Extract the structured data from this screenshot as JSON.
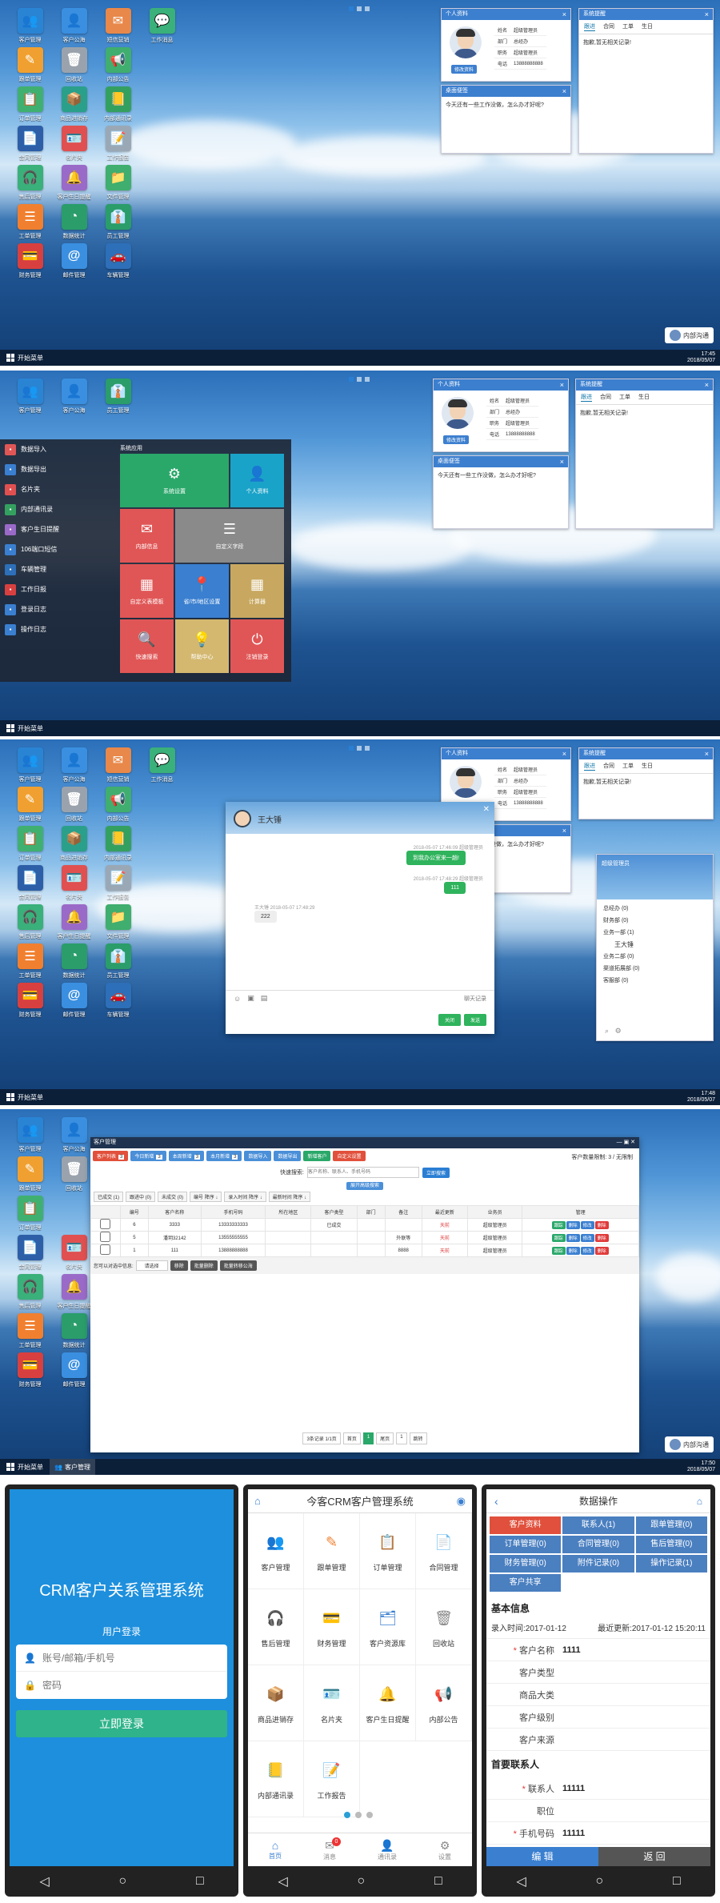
{
  "taskbar": {
    "start": "开始菜单",
    "time1": "17:45",
    "date1": "2018/05/07",
    "time3": "17:48",
    "date3": "2018/05/07",
    "time4": "17:50",
    "date4": "2018/05/07",
    "task_crm": "客户管理"
  },
  "desktop": {
    "icons": [
      {
        "label": "客户管理",
        "icon": "user-icon",
        "color": "#2a84d4",
        "glyph": "👥"
      },
      {
        "label": "客户公海",
        "icon": "users-icon",
        "color": "#3a8fe0",
        "glyph": "👤"
      },
      {
        "label": "短信营销",
        "icon": "mail-icon",
        "color": "#e8884a",
        "glyph": "✉"
      },
      {
        "label": "工作消息",
        "icon": "chat-icon",
        "color": "#3ab07a",
        "glyph": "💬"
      },
      {
        "label": "跟单管理",
        "icon": "edit-icon",
        "color": "#f0a030",
        "glyph": "✎"
      },
      {
        "label": "回收站",
        "icon": "trash-icon",
        "color": "#9aa3ad",
        "glyph": "🗑"
      },
      {
        "label": "内部公告",
        "icon": "notice-icon",
        "color": "#3fae6e",
        "glyph": "📢"
      },
      {
        "label": "订单管理",
        "icon": "order-icon",
        "color": "#40b070",
        "glyph": "📋"
      },
      {
        "label": "商品进销存",
        "icon": "box-icon",
        "color": "#2aa08a",
        "glyph": "📦"
      },
      {
        "label": "内部通讯录",
        "icon": "contacts-icon",
        "color": "#34a060",
        "glyph": "📒"
      },
      {
        "label": "合同管理",
        "icon": "contract-icon",
        "color": "#2d5fa8",
        "glyph": "📄"
      },
      {
        "label": "名片夹",
        "icon": "card-icon",
        "color": "#e05050",
        "glyph": "🪪"
      },
      {
        "label": "工作报告",
        "icon": "report-icon",
        "color": "#9aa8b6",
        "glyph": "📝"
      },
      {
        "label": "售后管理",
        "icon": "service-icon",
        "color": "#3ab07a",
        "glyph": "🎧"
      },
      {
        "label": "客户生日提醒",
        "icon": "bell-icon",
        "color": "#9a6ac8",
        "glyph": "🔔"
      },
      {
        "label": "文件管理",
        "icon": "folder-icon",
        "color": "#3fae6e",
        "glyph": "📁"
      },
      {
        "label": "工单管理",
        "icon": "list-icon",
        "color": "#f08030",
        "glyph": "☰"
      },
      {
        "label": "数据统计",
        "icon": "pie-icon",
        "color": "#2a9d6a",
        "glyph": "◔"
      },
      {
        "label": "员工管理",
        "icon": "staff-icon",
        "color": "#2a9d6a",
        "glyph": "👔"
      },
      {
        "label": "财务管理",
        "icon": "wallet-icon",
        "color": "#d84040",
        "glyph": "💳"
      },
      {
        "label": "邮件管理",
        "icon": "at-icon",
        "color": "#3a8fe0",
        "glyph": "@"
      },
      {
        "label": "车辆管理",
        "icon": "car-icon",
        "color": "#2d6fb8",
        "glyph": "🚗"
      }
    ]
  },
  "profile": {
    "title": "个人资料",
    "edit": "修改资料",
    "rows": [
      [
        "姓名",
        "超级管理员"
      ],
      [
        "部门",
        "总经办"
      ],
      [
        "职务",
        "超级管理员"
      ],
      [
        "电话",
        "13888888888"
      ]
    ]
  },
  "remind": {
    "title": "系统提醒",
    "tabs": [
      "跟进",
      "合同",
      "工单",
      "生日"
    ],
    "empty": "抱歉,暂无相关记录!"
  },
  "memo": {
    "title": "桌面便签",
    "text": "今天还有一些工作没做，怎么办才好呢?"
  },
  "internal_chat": {
    "label": "内部沟通"
  },
  "start_menu": {
    "list": [
      "数据导入",
      "数据导出",
      "名片夹",
      "内部通讯录",
      "客户生日提醒",
      "106端口短信",
      "车辆管理",
      "工作日报",
      "登录日志",
      "操作日志"
    ],
    "title": "系统应用",
    "tiles": [
      {
        "label": "系统设置",
        "color": "#2aa86a",
        "glyph": "⚙"
      },
      {
        "label": "个人资料",
        "color": "#1aa3c8",
        "glyph": "👤"
      },
      {
        "label": "内部信息",
        "color": "#e05656",
        "glyph": "✉"
      },
      {
        "label": "自定义字段",
        "color": "#8a8a8a",
        "glyph": "☰"
      },
      {
        "label": "自定义表模板",
        "color": "#e05656",
        "glyph": "▦"
      },
      {
        "label": "省/市/地区设置",
        "color": "#3a7fd0",
        "glyph": "📍"
      },
      {
        "label": "计算器",
        "color": "#c8a860",
        "glyph": "▦"
      },
      {
        "label": "快速搜索",
        "color": "#e05656",
        "glyph": "🔍"
      },
      {
        "label": "帮助中心",
        "color": "#d4b870",
        "glyph": "💡"
      },
      {
        "label": "注销登录",
        "color": "#e05656",
        "glyph": "⏻"
      }
    ]
  },
  "chat": {
    "name": "王大锤",
    "messages": [
      {
        "side": "right",
        "meta": "2018-05-07 17:46:09 超级管理员",
        "text": "到我办公室来一趟!"
      },
      {
        "side": "right",
        "meta": "2018-05-07 17:48:29 超级管理员",
        "text": "111"
      },
      {
        "side": "left",
        "meta": "王大锤 2018-05-07 17:48:29",
        "text": "222"
      }
    ],
    "history": "聊天记录",
    "close": "关闭",
    "send": "发送"
  },
  "org": {
    "user": "超级管理员",
    "tree": [
      "总经办 (0)",
      "财务部 (0)",
      "业务一部 (1)",
      "王大锤",
      "业务二部 (0)",
      "渠道拓展部 (0)",
      "客服部 (0)"
    ]
  },
  "crm": {
    "title": "客户管理",
    "buttons": [
      {
        "label": "客户列表",
        "badge": "3",
        "color": "#e1503c"
      },
      {
        "label": "今日新增",
        "badge": "3",
        "color": "#4a8fd8"
      },
      {
        "label": "本周新增",
        "badge": "3",
        "color": "#4a8fd8"
      },
      {
        "label": "本月新增",
        "badge": "3",
        "color": "#4a8fd8"
      },
      {
        "label": "数据导入",
        "badge": "",
        "color": "#4a8fd8"
      },
      {
        "label": "数据导出",
        "badge": "",
        "color": "#4a8fd8"
      },
      {
        "label": "新增客户",
        "badge": "",
        "color": "#2aa86a"
      },
      {
        "label": "自定义设置",
        "badge": "",
        "color": "#e1503c"
      }
    ],
    "quota": "客户数量限制: 3 / 无限制",
    "search_label": "快速搜索:",
    "search_placeholder": "客户名称、联系人、手机号码",
    "search_btn": "立即搜索",
    "adv_search": "展开高级搜索",
    "filters": [
      "已成交 (1)",
      "跟进中 (0)",
      "未成交 (0)",
      "编号 降序 ↓",
      "录入时间 降序 ↓",
      "最新时间 降序 ↓"
    ],
    "headers": [
      "",
      "编号",
      "客户名称",
      "手机号码",
      "所在地区",
      "客户类型",
      "部门",
      "备注",
      "最近更新",
      "业务员",
      "管理"
    ],
    "rows": [
      [
        "",
        "6",
        "3333",
        "13333333333",
        "",
        "已成交",
        "",
        "",
        "天前",
        "超级管理员"
      ],
      [
        "",
        "5",
        "潘玥32142",
        "13555555555",
        "",
        "",
        "",
        "外联等",
        "天前",
        "超级管理员"
      ],
      [
        "",
        "1",
        "111",
        "13888888888",
        "",
        "",
        "",
        "8888",
        "天前",
        "超级管理员"
      ]
    ],
    "ops": [
      "跟踪",
      "删除",
      "修改",
      "删除"
    ],
    "batch_label": "您可以对选中信息:",
    "batch_select": "请选择",
    "batch_btns": [
      "移除",
      "批量删除",
      "批量转移公海"
    ],
    "pager": "3条记录 1/1页",
    "pager_links": [
      "首页",
      "1",
      "尾页",
      "1",
      "跳转"
    ]
  },
  "login": {
    "title": "CRM客户关系管理系统",
    "subtitle": "用户登录",
    "user_placeholder": "账号/邮箱/手机号",
    "pass_placeholder": "密码",
    "submit": "立即登录"
  },
  "home": {
    "title": "今客CRM客户管理系统",
    "apps": [
      {
        "label": "客户管理",
        "glyph": "👥",
        "color": "#3a7fd0"
      },
      {
        "label": "跟单管理",
        "glyph": "✎",
        "color": "#f08030"
      },
      {
        "label": "订单管理",
        "glyph": "📋",
        "color": "#40b070"
      },
      {
        "label": "合同管理",
        "glyph": "📄",
        "color": "#2d5fa8"
      },
      {
        "label": "售后管理",
        "glyph": "🎧",
        "color": "#2aa86a"
      },
      {
        "label": "财务管理",
        "glyph": "💳",
        "color": "#d84040"
      },
      {
        "label": "客户资源库",
        "glyph": "🗂",
        "color": "#3a7fd0"
      },
      {
        "label": "回收站",
        "glyph": "🗑",
        "color": "#888"
      },
      {
        "label": "商品进销存",
        "glyph": "📦",
        "color": "#2aa08a"
      },
      {
        "label": "名片夹",
        "glyph": "🪪",
        "color": "#e05050"
      },
      {
        "label": "客户生日提醒",
        "glyph": "🔔",
        "color": "#9a6ac8"
      },
      {
        "label": "内部公告",
        "glyph": "📢",
        "color": "#3fae6e"
      },
      {
        "label": "内部通讯录",
        "glyph": "📒",
        "color": "#34a060"
      },
      {
        "label": "工作报告",
        "glyph": "📝",
        "color": "#6a8ab0"
      }
    ],
    "bottom": [
      "首页",
      "消息",
      "通讯录",
      "设置"
    ],
    "badge": "0"
  },
  "detail": {
    "title": "数据操作",
    "tabs": [
      "客户资料",
      "联系人(1)",
      "跟单管理(0)",
      "订单管理(0)",
      "合同管理(0)",
      "售后管理(0)",
      "财务管理(0)",
      "附件记录(0)",
      "操作记录(1)",
      "客户共享"
    ],
    "basic": "基本信息",
    "meta_left": "录入时间:2017-01-12",
    "meta_right": "最近更新:2017-01-12 15:20:11",
    "fields": [
      {
        "k": "客户名称",
        "v": "1111",
        "req": true
      },
      {
        "k": "客户类型",
        "v": ""
      },
      {
        "k": "商品大类",
        "v": ""
      },
      {
        "k": "客户级别",
        "v": ""
      },
      {
        "k": "客户来源",
        "v": ""
      }
    ],
    "contact": "首要联系人",
    "cfields": [
      {
        "k": "联系人",
        "v": "11111",
        "req": true
      },
      {
        "k": "职位",
        "v": ""
      },
      {
        "k": "手机号码",
        "v": "11111",
        "req": true
      }
    ],
    "edit": "编 辑",
    "back": "返 回"
  }
}
